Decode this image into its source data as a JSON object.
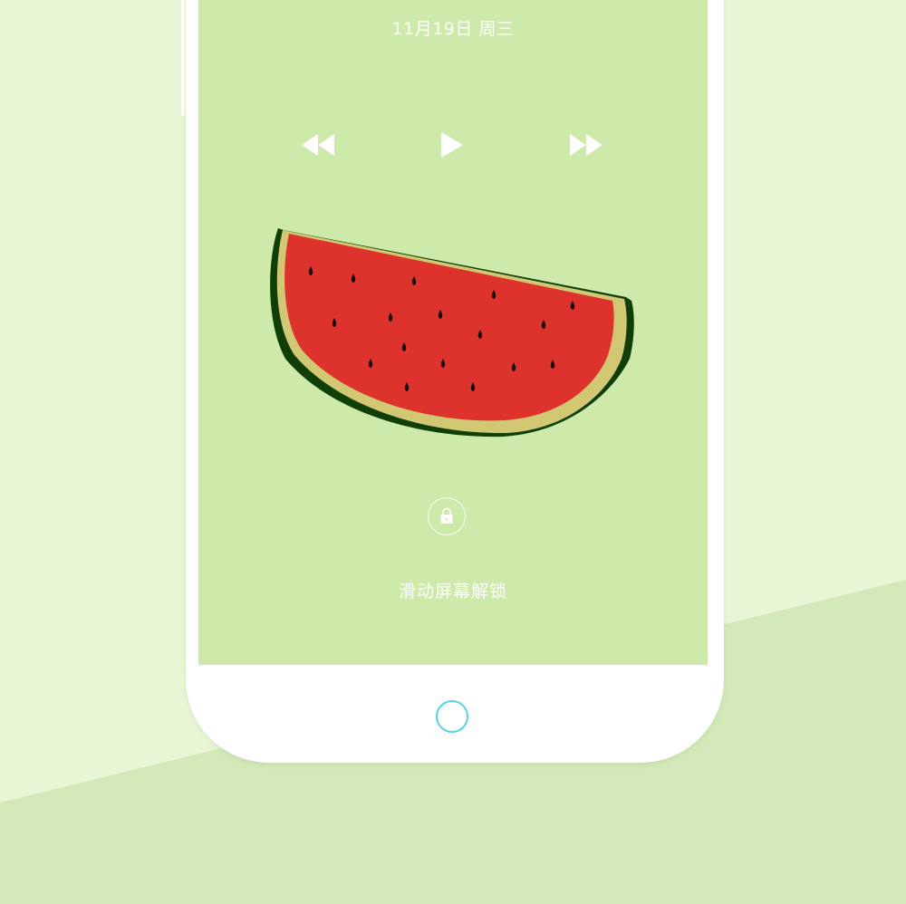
{
  "lockscreen": {
    "date": "11月19日 周三",
    "unlock_hint": "滑动屏幕解锁"
  },
  "media_controls": [
    "rewind-icon",
    "play-icon",
    "fast-forward-icon"
  ],
  "wallpaper": {
    "subject": "watermark-free watermelon slice illustration"
  },
  "colors": {
    "background": "#e8f6d6",
    "background_lower": "#d3e9b9",
    "screen": "#cdeaaa",
    "watermelon_flesh": "#dd332c",
    "watermelon_rind": "#d2c873",
    "watermelon_skin": "#0f3f05",
    "seeds": "#1a0f0c",
    "home_button_ring": "#55d4e6"
  }
}
